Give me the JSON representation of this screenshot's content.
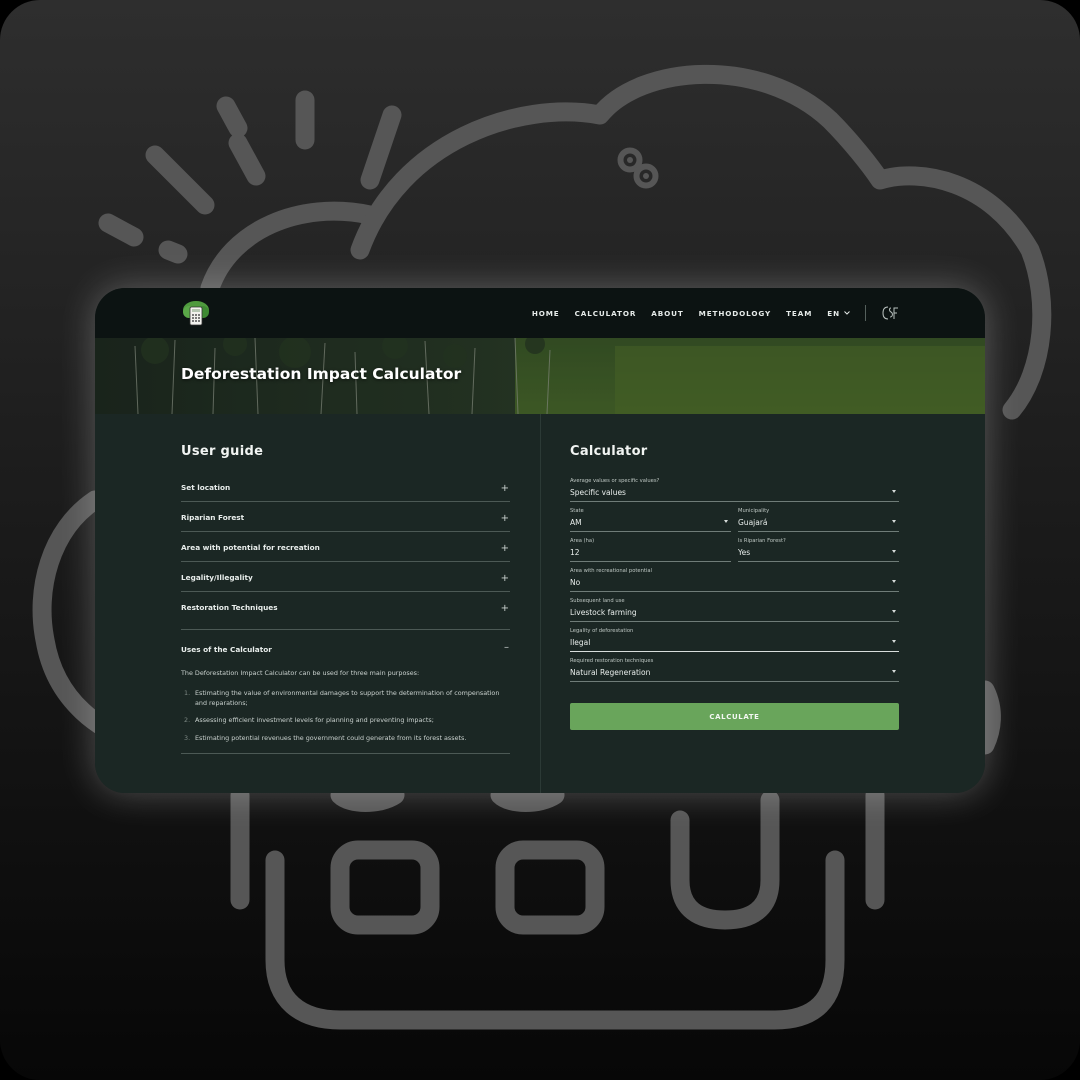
{
  "nav": {
    "links": [
      "HOME",
      "CALCULATOR",
      "ABOUT",
      "METHODOLOGY",
      "TEAM"
    ],
    "language": "EN"
  },
  "hero": {
    "title": "Deforestation Impact Calculator"
  },
  "user_guide": {
    "title": "User guide",
    "items": [
      {
        "label": "Set location",
        "state": "+"
      },
      {
        "label": "Riparian Forest",
        "state": "+"
      },
      {
        "label": "Area with potential for recreation",
        "state": "+"
      },
      {
        "label": "Legality/Illegality",
        "state": "+"
      },
      {
        "label": "Restoration Techniques",
        "state": "+"
      }
    ],
    "expanded": {
      "label": "Uses of the Calculator",
      "state": "–",
      "intro": "The Deforestation Impact Calculator can be used for three main purposes:",
      "list": [
        {
          "num": "1.",
          "text": "Estimating the value of environmental damages to support the determination of compensation and reparations;"
        },
        {
          "num": "2.",
          "text": "Assessing efficient investment levels for planning and preventing impacts;"
        },
        {
          "num": "3.",
          "text": "Estimating potential revenues the government could generate from its forest assets."
        }
      ]
    }
  },
  "calculator": {
    "title": "Calculator",
    "fields": {
      "values_type": {
        "label": "Average values or specific values?",
        "value": "Specific values"
      },
      "state": {
        "label": "State",
        "value": "AM"
      },
      "municipality": {
        "label": "Municipality",
        "value": "Guajará"
      },
      "area": {
        "label": "Area (ha)",
        "value": "12"
      },
      "riparian": {
        "label": "Is Riparian Forest?",
        "value": "Yes"
      },
      "recreation": {
        "label": "Area with recreational potential",
        "value": "No"
      },
      "land_use": {
        "label": "Subsequent land use",
        "value": "Livestock farming"
      },
      "legality": {
        "label": "Legality of deforestation",
        "value": "Ilegal"
      },
      "restoration": {
        "label": "Required restoration techniques",
        "value": "Natural Regeneration"
      }
    },
    "button_label": "CALCULATE"
  },
  "colors": {
    "accent_button": "#69a55b",
    "panel": "#1b2724",
    "nav": "#0c1312"
  }
}
